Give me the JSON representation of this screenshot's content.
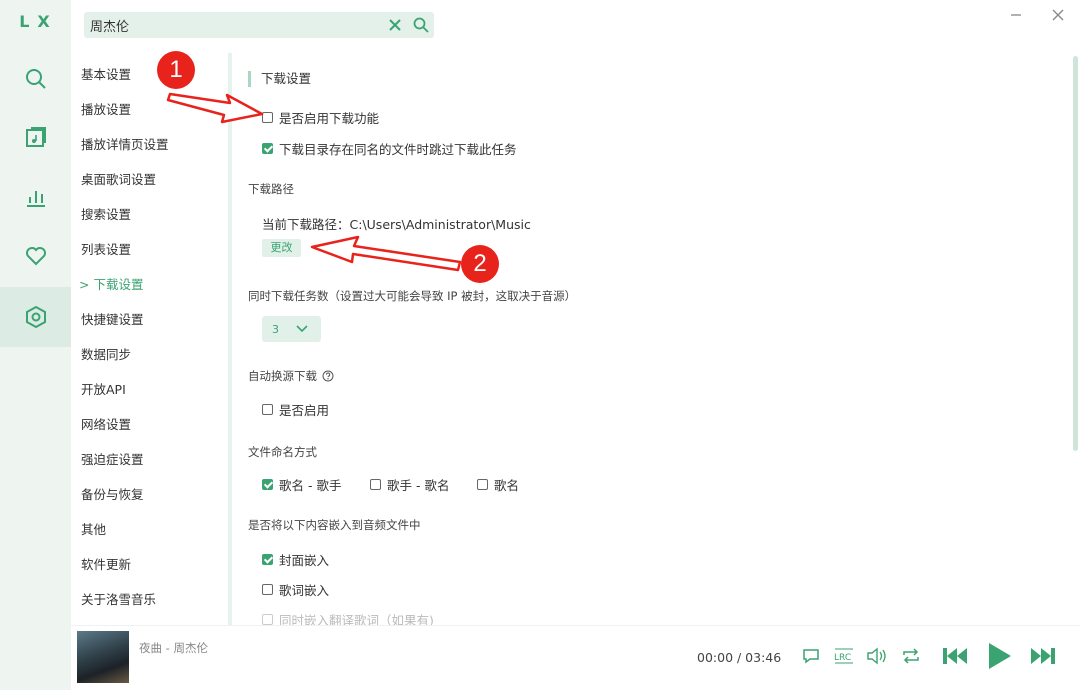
{
  "app": {
    "logo": "LX"
  },
  "search": {
    "value": "周杰伦",
    "placeholder": ""
  },
  "rail": {
    "items": [
      "search-icon",
      "song-list-icon",
      "leaderboard-icon",
      "heart-icon",
      "settings-icon"
    ]
  },
  "menu": {
    "items": [
      "基本设置",
      "播放设置",
      "播放详情页设置",
      "桌面歌词设置",
      "搜索设置",
      "列表设置",
      "下载设置",
      "快捷键设置",
      "数据同步",
      "开放API",
      "网络设置",
      "强迫症设置",
      "备份与恢复",
      "其他",
      "软件更新",
      "关于洛雪音乐"
    ],
    "active_index": 6,
    "active_marker": ">"
  },
  "content": {
    "title": "下载设置",
    "enable_download": {
      "label": "是否启用下载功能",
      "checked": false
    },
    "skip_existing": {
      "label": "下载目录存在同名的文件时跳过下载此任务",
      "checked": true
    },
    "path_heading": "下载路径",
    "current_path": "当前下载路径：C:\\Users\\Administrator\\Music",
    "change_button": "更改",
    "concurrent_heading": "同时下载任务数（设置过大可能会导致 IP 被封，这取决于音源）",
    "concurrent_value": "3",
    "auto_switch_heading": "自动换源下载",
    "auto_switch": {
      "label": "是否启用",
      "checked": false
    },
    "naming_heading": "文件命名方式",
    "naming_options": [
      {
        "label": "歌名 - 歌手",
        "checked": true
      },
      {
        "label": "歌手 - 歌名",
        "checked": false
      },
      {
        "label": "歌名",
        "checked": false
      }
    ],
    "embed_heading": "是否将以下内容嵌入到音频文件中",
    "embed_cover": {
      "label": "封面嵌入",
      "checked": true
    },
    "embed_lyrics": {
      "label": "歌词嵌入",
      "checked": false
    },
    "embed_translated": {
      "label": "同时嵌入翻译歌词（如果有)",
      "checked": false
    }
  },
  "player": {
    "song": "夜曲 - 周杰伦",
    "time": "00:00 / 03:46"
  },
  "annotations": {
    "badge1": "1",
    "badge2": "2"
  },
  "colors": {
    "accent": "#3aa372",
    "annotation": "#e8231c"
  }
}
